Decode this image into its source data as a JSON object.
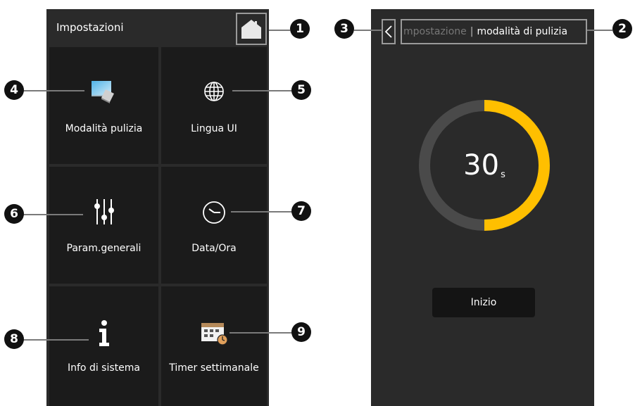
{
  "left_screen": {
    "header": {
      "title": "Impostazioni",
      "home_icon": "home-icon"
    },
    "tiles": [
      {
        "label": "Modalità pulizia",
        "icon": "cleaning-mode-icon"
      },
      {
        "label": "Lingua UI",
        "icon": "globe-icon"
      },
      {
        "label": "Param.generali",
        "icon": "sliders-icon"
      },
      {
        "label": "Data/Ora",
        "icon": "clock-icon"
      },
      {
        "label": "Info di sistema",
        "icon": "info-icon"
      },
      {
        "label": "Timer settimanale",
        "icon": "weekly-timer-icon"
      }
    ]
  },
  "right_screen": {
    "breadcrumb": {
      "parent": "mpostazione",
      "separator": "|",
      "current": "modalità di pulizia"
    },
    "timer": {
      "value": "30",
      "unit": "s",
      "progress_fraction": 0.5
    },
    "start_button": "Inizio",
    "colors": {
      "ring_track": "#4a4a4a",
      "ring_progress": "#ffbf00"
    }
  },
  "callouts": [
    "1",
    "2",
    "3",
    "4",
    "5",
    "6",
    "7",
    "8",
    "9"
  ]
}
